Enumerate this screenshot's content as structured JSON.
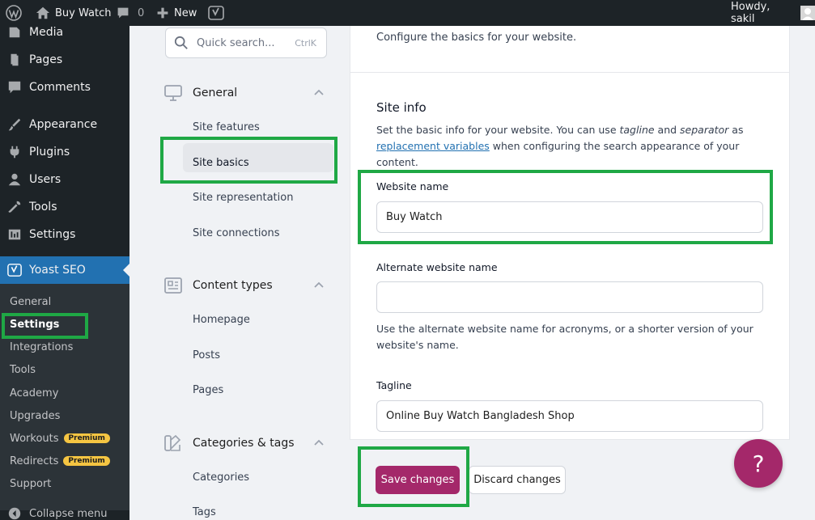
{
  "adminbar": {
    "site_name": "Buy Watch",
    "comments_count": "0",
    "new_label": "New",
    "howdy": "Howdy, sakil"
  },
  "admin_menu": {
    "items": [
      {
        "label": "Media",
        "icon": "media-icon"
      },
      {
        "label": "Pages",
        "icon": "pages-icon"
      },
      {
        "label": "Comments",
        "icon": "comments-icon"
      },
      {
        "label": "Appearance",
        "icon": "appearance-icon"
      },
      {
        "label": "Plugins",
        "icon": "plugins-icon"
      },
      {
        "label": "Users",
        "icon": "users-icon"
      },
      {
        "label": "Tools",
        "icon": "tools-icon"
      },
      {
        "label": "Settings",
        "icon": "settings-icon"
      },
      {
        "label": "Yoast SEO",
        "icon": "yoast-icon"
      }
    ],
    "submenu": [
      {
        "label": "General"
      },
      {
        "label": "Settings"
      },
      {
        "label": "Integrations"
      },
      {
        "label": "Tools"
      },
      {
        "label": "Academy"
      },
      {
        "label": "Upgrades"
      },
      {
        "label": "Workouts",
        "badge": "Premium"
      },
      {
        "label": "Redirects",
        "badge": "Premium"
      },
      {
        "label": "Support"
      }
    ],
    "collapse": "Collapse menu"
  },
  "yoast_nav": {
    "search_placeholder": "Quick search...",
    "search_shortcut": "CtrlK",
    "groups": [
      {
        "label": "General",
        "links": [
          "Site features",
          "Site basics",
          "Site representation",
          "Site connections"
        ]
      },
      {
        "label": "Content types",
        "links": [
          "Homepage",
          "Posts",
          "Pages"
        ]
      },
      {
        "label": "Categories & tags",
        "links": [
          "Categories",
          "Tags"
        ]
      }
    ]
  },
  "main": {
    "intro": "Configure the basics for your website.",
    "section_title": "Site info",
    "section_desc_1": "Set the basic info for your website. You can use ",
    "section_desc_tagline": "tagline",
    "section_desc_and": " and ",
    "section_desc_separator": "separator",
    "section_desc_as": " as",
    "section_desc_link": "replacement variables",
    "section_desc_2": " when configuring the search appearance of your content.",
    "website_name_label": "Website name",
    "website_name_value": "Buy Watch",
    "alt_name_label": "Alternate website name",
    "alt_name_value": "",
    "alt_name_help": "Use the alternate website name for acronyms, or a shorter version of your website's name.",
    "tagline_label": "Tagline",
    "tagline_value": "Online Buy Watch Bangladesh Shop"
  },
  "footer": {
    "save_label": "Save changes",
    "discard_label": "Discard changes"
  },
  "help_label": "?",
  "colors": {
    "admin_dark": "#1d2327",
    "wp_blue": "#2271b1",
    "yoast_primary": "#a4286a",
    "highlight_green": "#1fa845"
  }
}
